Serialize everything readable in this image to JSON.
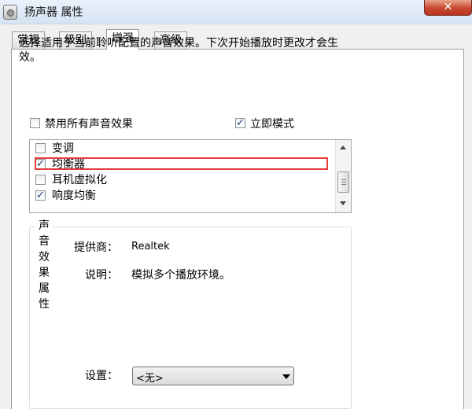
{
  "window": {
    "title": "扬声器 属性",
    "close_glyph": "✕"
  },
  "tabs": [
    {
      "label": "常规",
      "active": false
    },
    {
      "label": "级别",
      "active": false
    },
    {
      "label": "增强",
      "active": true
    },
    {
      "label": "高级",
      "active": false
    }
  ],
  "enhancements": {
    "description": "选择适用于当前聆听配置的声音效果。下次开始播放时更改才会生效。",
    "disable_all": {
      "label": "禁用所有声音效果",
      "checked": false
    },
    "immediate_mode": {
      "label": "立即模式",
      "checked": true
    },
    "effects": [
      {
        "label": "变调",
        "checked": false
      },
      {
        "label": "均衡器",
        "checked": true
      },
      {
        "label": "耳机虚拟化",
        "checked": false
      },
      {
        "label": "响度均衡",
        "checked": true
      }
    ]
  },
  "properties": {
    "legend": "声音效果属性",
    "provider_label": "提供商：",
    "provider_value": "Realtek",
    "description_label": "说明：",
    "description_value": "模拟多个播放环境。",
    "settings_label": "设置：",
    "settings_value": "<无>"
  },
  "colors": {
    "highlight": "#e53e3e",
    "close_button": "#c9472f"
  }
}
